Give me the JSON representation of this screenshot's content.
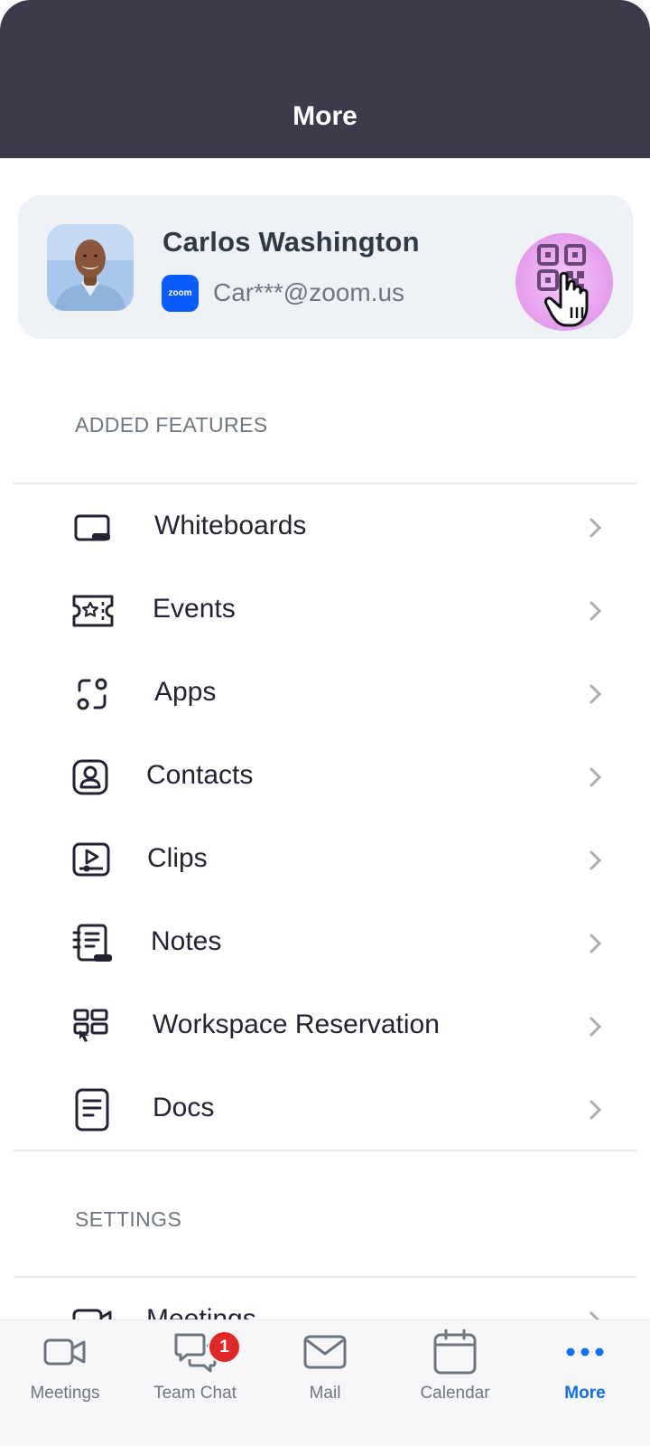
{
  "header": {
    "title": "More"
  },
  "profile": {
    "name": "Carlos Washington",
    "email": "Car***@zoom.us",
    "brand_badge": "zoom",
    "avatar_icon": "user-photo",
    "qr_icon": "qr-code-icon"
  },
  "sections": {
    "added_features": "ADDED FEATURES",
    "settings": "SETTINGS"
  },
  "features": [
    {
      "label": "Whiteboards",
      "icon": "whiteboard-icon"
    },
    {
      "label": "Events",
      "icon": "ticket-icon"
    },
    {
      "label": "Apps",
      "icon": "apps-icon"
    },
    {
      "label": "Contacts",
      "icon": "contact-icon"
    },
    {
      "label": "Clips",
      "icon": "clip-icon"
    },
    {
      "label": "Notes",
      "icon": "notes-icon"
    },
    {
      "label": "Workspace Reservation",
      "icon": "workspace-icon"
    },
    {
      "label": "Docs",
      "icon": "document-icon"
    }
  ],
  "settings_items": [
    {
      "label": "Meetings",
      "icon": "video-camera-icon"
    }
  ],
  "tabbar": {
    "tabs": [
      {
        "label": "Meetings",
        "icon": "video-camera-icon",
        "active": false
      },
      {
        "label": "Team Chat",
        "icon": "chat-bubbles-icon",
        "active": false,
        "badge": "1"
      },
      {
        "label": "Mail",
        "icon": "mail-icon",
        "active": false
      },
      {
        "label": "Calendar",
        "icon": "calendar-icon",
        "active": false
      },
      {
        "label": "More",
        "icon": "more-dots-icon",
        "active": true
      }
    ]
  },
  "colors": {
    "header_bg": "#3c3b4b",
    "card_bg": "#eef1f5",
    "accent": "#0e71eb",
    "badge": "#e02828",
    "qr_highlight": "#e9a6ef"
  }
}
